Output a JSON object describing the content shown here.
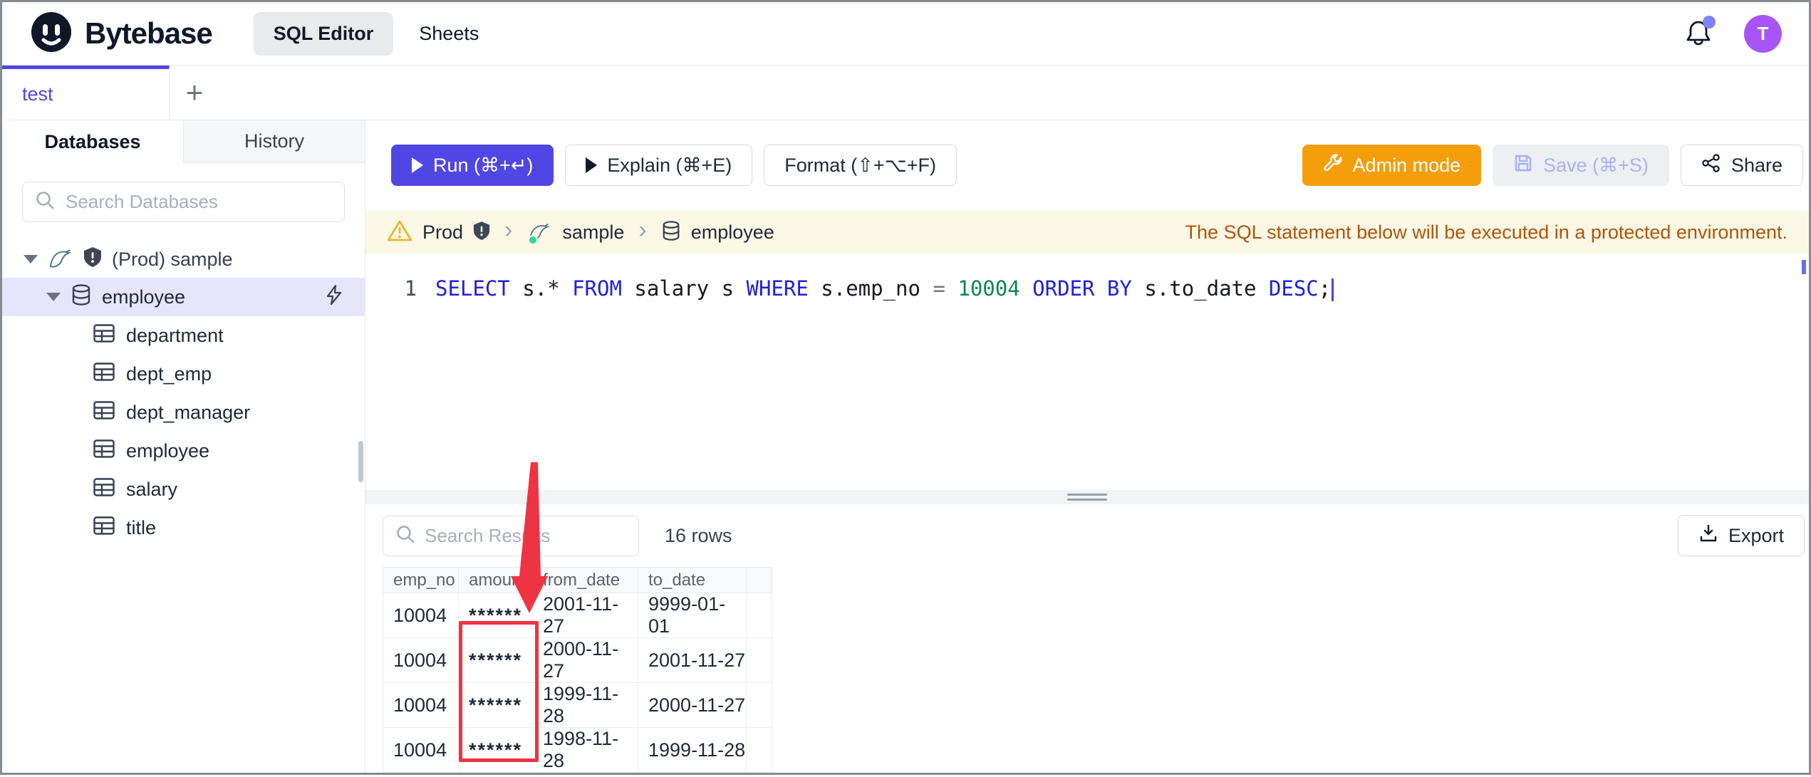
{
  "header": {
    "brand": "Bytebase",
    "nav": [
      {
        "label": "SQL Editor",
        "active": true
      },
      {
        "label": "Sheets",
        "active": false
      }
    ],
    "avatar_initial": "T"
  },
  "tab_strip": {
    "active_tab": "test",
    "add_label": "+"
  },
  "sidebar": {
    "tabs": {
      "databases": "Databases",
      "history": "History"
    },
    "search_placeholder": "Search Databases",
    "tree": {
      "connection": "(Prod) sample",
      "database": "employee",
      "tables": [
        "department",
        "dept_emp",
        "dept_manager",
        "employee",
        "salary",
        "title"
      ]
    }
  },
  "toolbar": {
    "run_label": "Run (⌘+↵)",
    "explain_label": "Explain (⌘+E)",
    "format_label": "Format (⇧+⌥+F)",
    "admin_label": "Admin mode",
    "save_label": "Save (⌘+S)",
    "share_label": "Share"
  },
  "breadcrumb": {
    "environment": "Prod",
    "database": "sample",
    "table": "employee",
    "notice": "The SQL statement below will be executed in a protected environment."
  },
  "editor": {
    "line_number": "1",
    "sql": "SELECT s.* FROM salary s WHERE s.emp_no = 10004 ORDER BY s.to_date DESC;",
    "tokens": [
      {
        "text": "SELECT",
        "type": "kw"
      },
      {
        "text": " s.* ",
        "type": "plain"
      },
      {
        "text": "FROM",
        "type": "kw"
      },
      {
        "text": " salary s ",
        "type": "plain"
      },
      {
        "text": "WHERE",
        "type": "kw"
      },
      {
        "text": " s.emp_no ",
        "type": "plain"
      },
      {
        "text": "=",
        "type": "op"
      },
      {
        "text": " ",
        "type": "plain"
      },
      {
        "text": "10004",
        "type": "num"
      },
      {
        "text": " ",
        "type": "plain"
      },
      {
        "text": "ORDER BY",
        "type": "kw"
      },
      {
        "text": " s.to_date ",
        "type": "plain"
      },
      {
        "text": "DESC",
        "type": "kw"
      },
      {
        "text": ";",
        "type": "plain"
      }
    ]
  },
  "results": {
    "search_placeholder": "Search Results",
    "row_count": "16 rows",
    "export_label": "Export",
    "table": {
      "columns": [
        "emp_no",
        "amount",
        "from_date",
        "to_date"
      ],
      "rows": [
        [
          "10004",
          "******",
          "2001-11-27",
          "9999-01-01"
        ],
        [
          "10004",
          "******",
          "2000-11-27",
          "2001-11-27"
        ],
        [
          "10004",
          "******",
          "1999-11-28",
          "2000-11-27"
        ],
        [
          "10004",
          "******",
          "1998-11-28",
          "1999-11-28"
        ]
      ]
    }
  },
  "icons": {
    "logo": "bytebase-mascot",
    "notification": "bell",
    "search": "magnifier",
    "connection": "mysql-dolphin",
    "environment": "shield-exclamation",
    "database": "cylinder",
    "table": "grid",
    "quick-action": "lightning-bolt",
    "warning": "triangle-exclamation",
    "admin": "wrench",
    "save": "floppy-disk",
    "share": "share-nodes",
    "export": "download",
    "run": "play",
    "explain": "play"
  },
  "colors": {
    "accent": "#4f46e5",
    "admin_orange": "#f59e0b",
    "annotation_red": "#ee3343",
    "avatar_purple": "#a855f7",
    "notification_dot": "#7d84f5",
    "warning_bg": "#fbf8e6",
    "warning_text": "#b45309",
    "keyword_blue": "#2121de",
    "number_green": "#0b8658",
    "selected_tree_bg": "#e7e5fc"
  }
}
